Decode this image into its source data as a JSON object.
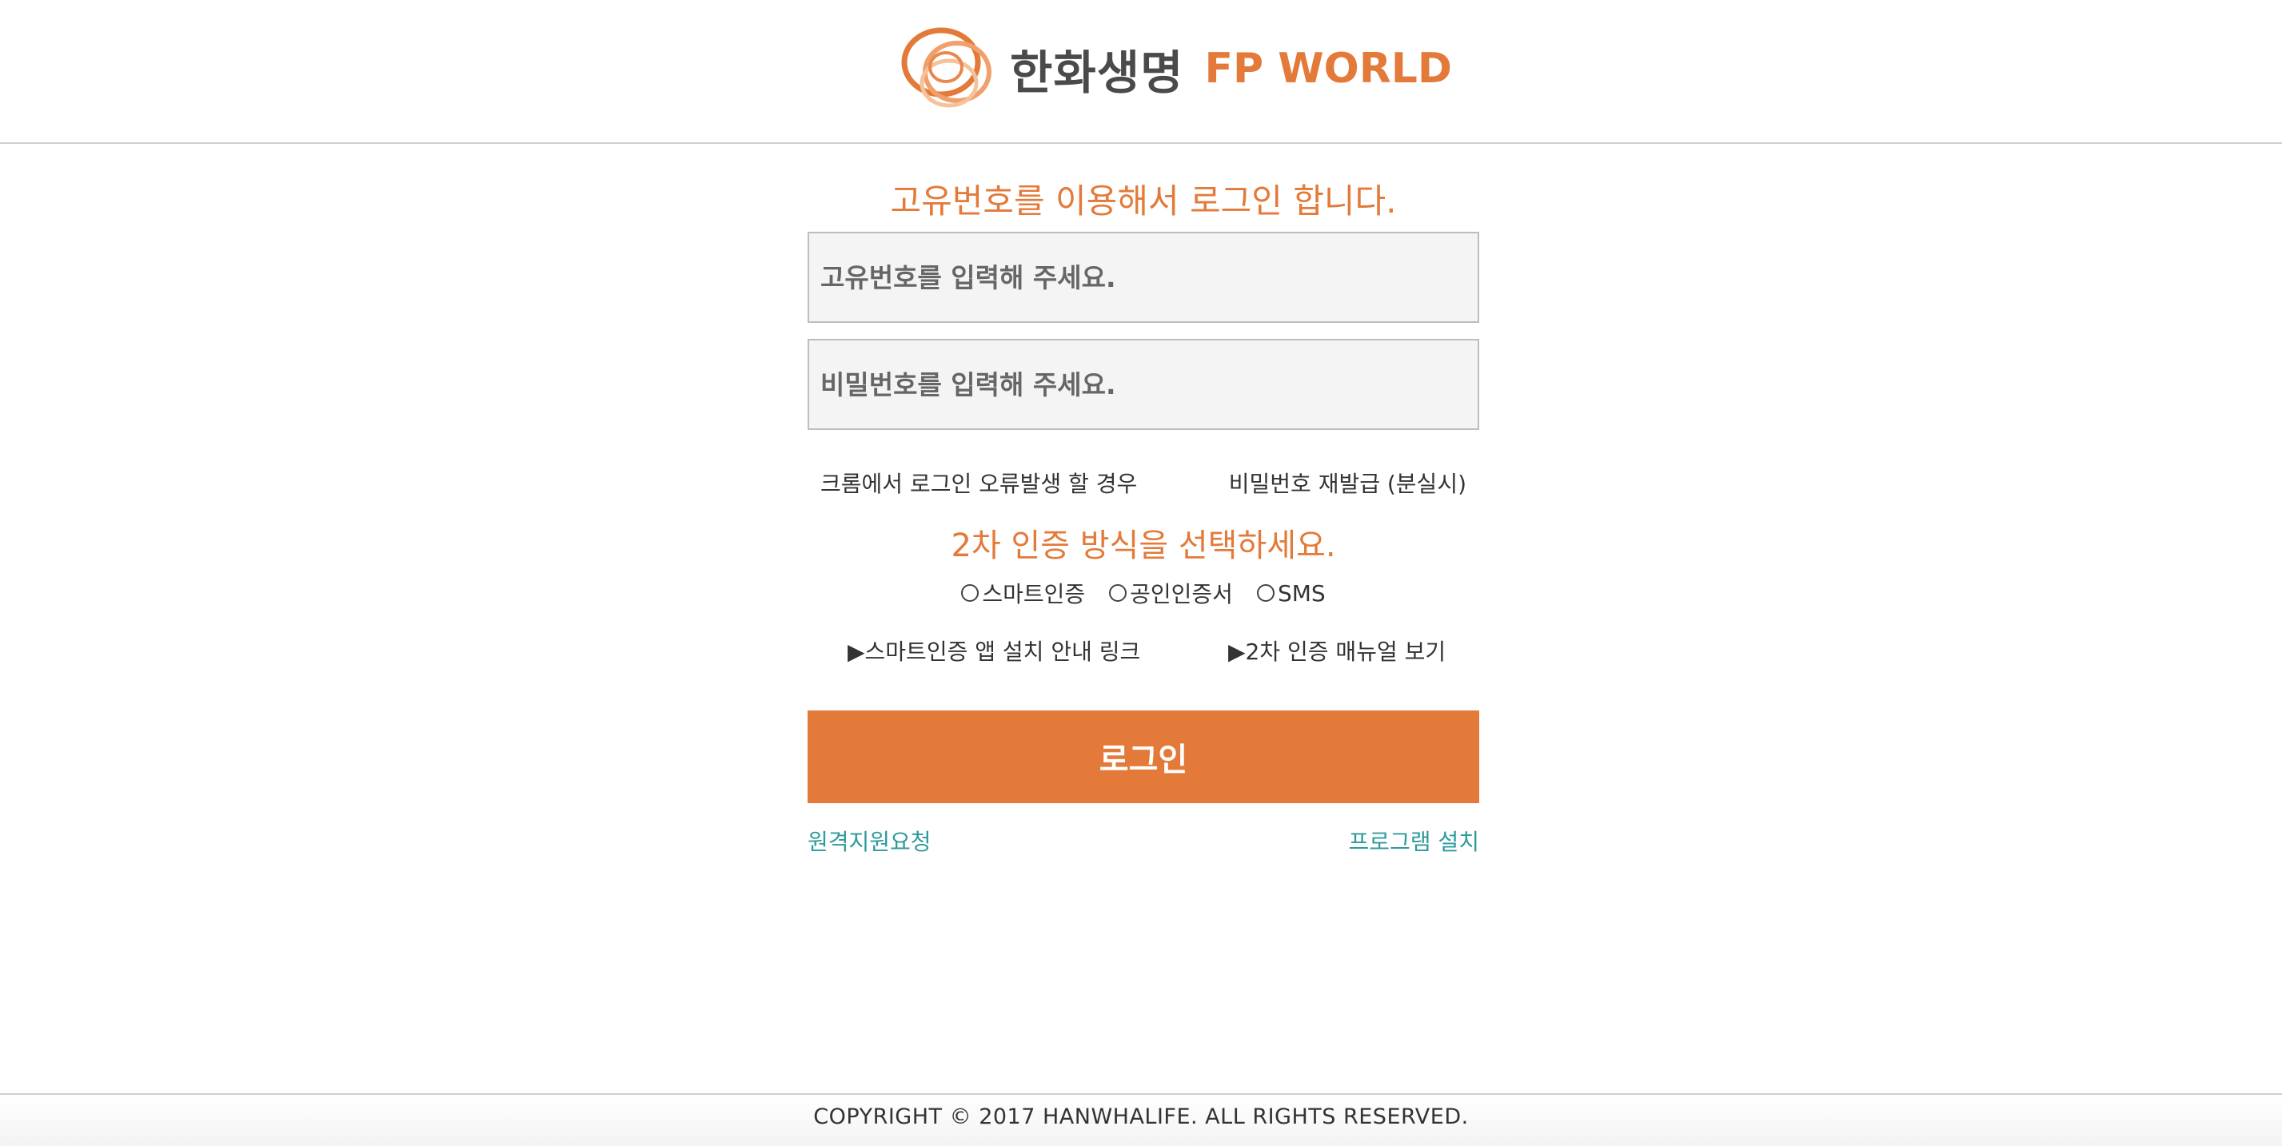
{
  "brand": {
    "name_ko": "한화생명",
    "name_en": "FP WORLD",
    "accent_color": "#e37a3a",
    "link_color": "#2e9a9c"
  },
  "login": {
    "title": "고유번호를 이용해서 로그인 합니다.",
    "id_placeholder": "고유번호를 입력해 주세요.",
    "password_placeholder": "비밀번호를 입력해 주세요.",
    "chrome_error_link": "크롬에서 로그인 오류발생 할 경우",
    "password_reset_link": "비밀번호 재발급 (분실시)",
    "submit_label": "로그인"
  },
  "auth": {
    "title": "2차 인증 방식을 선택하세요.",
    "options": [
      "스마트인증",
      "공인인증서",
      "SMS"
    ],
    "smart_app_guide_link": "▶스마트인증 앱 설치 안내 링크",
    "manual_link": "▶2차 인증 매뉴얼 보기"
  },
  "links": {
    "remote_support": "원격지원요청",
    "program_install": "프로그램 설치"
  },
  "footer": {
    "copyright": "COPYRIGHT © 2017 HANWHALIFE. ALL RIGHTS RESERVED."
  }
}
